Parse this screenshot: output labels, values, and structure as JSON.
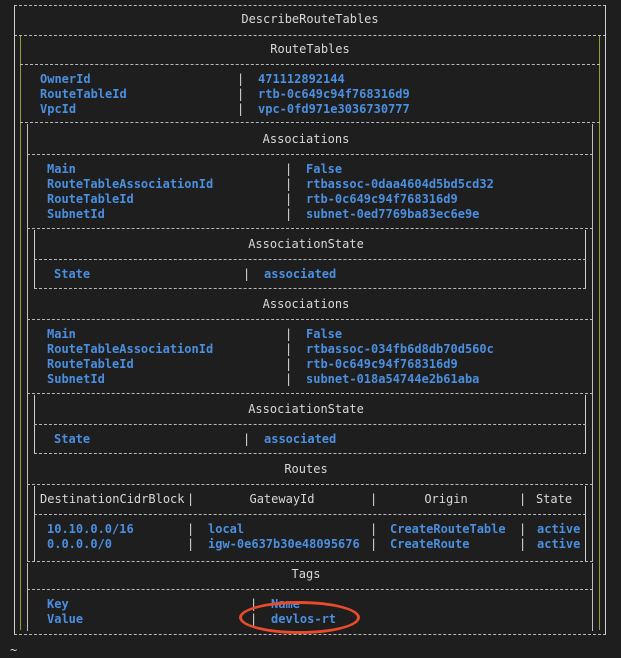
{
  "title": "DescribeRouteTables",
  "route_tables_header": "RouteTables",
  "route_table": {
    "owner_id_key": "OwnerId",
    "owner_id_val": "471112892144",
    "rt_id_key": "RouteTableId",
    "rt_id_val": "rtb-0c649c94f768316d9",
    "vpc_id_key": "VpcId",
    "vpc_id_val": "vpc-0fd971e3036730777"
  },
  "associations_header": "Associations",
  "assoc1": {
    "main_key": "Main",
    "main_val": "False",
    "assoc_id_key": "RouteTableAssociationId",
    "assoc_id_val": "rtbassoc-0daa4604d5bd5cd32",
    "rt_id_key": "RouteTableId",
    "rt_id_val": "rtb-0c649c94f768316d9",
    "subnet_key": "SubnetId",
    "subnet_val": "subnet-0ed7769ba83ec6e9e"
  },
  "assoc_state_header": "AssociationState",
  "assoc1_state": {
    "state_key": "State",
    "state_val": "associated"
  },
  "assoc2": {
    "main_key": "Main",
    "main_val": "False",
    "assoc_id_key": "RouteTableAssociationId",
    "assoc_id_val": "rtbassoc-034fb6d8db70d560c",
    "rt_id_key": "RouteTableId",
    "rt_id_val": "rtb-0c649c94f768316d9",
    "subnet_key": "SubnetId",
    "subnet_val": "subnet-018a54744e2b61aba"
  },
  "assoc2_state": {
    "state_key": "State",
    "state_val": "associated"
  },
  "routes_header": "Routes",
  "routes_columns": [
    "DestinationCidrBlock",
    "GatewayId",
    "Origin",
    "State"
  ],
  "routes": [
    {
      "dest": "10.10.0.0/16",
      "gw": "local",
      "origin": "CreateRouteTable",
      "state": "active"
    },
    {
      "dest": "0.0.0.0/0",
      "gw": "igw-0e637b30e48095676",
      "origin": "CreateRoute",
      "state": "active"
    }
  ],
  "tags_header": "Tags",
  "tags": {
    "key_label": "Key",
    "key_val": "Name",
    "value_label": "Value",
    "value_val": "devlos-rt"
  },
  "prompt": "~"
}
